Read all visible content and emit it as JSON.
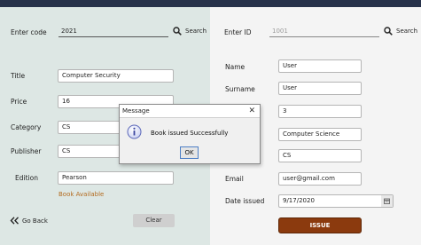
{
  "left": {
    "code_label": "Enter code",
    "code_value": "2021",
    "search_label": "Search",
    "title_label": "Title",
    "title_value": "Computer Security",
    "price_label": "Price",
    "price_value": "16",
    "category_label": "Category",
    "category_value": "CS",
    "publisher_label": "Publisher",
    "publisher_value": "CS",
    "edition_label": "Edition",
    "edition_value": "Pearson",
    "availability": "Book Available",
    "go_back_label": "Go Back",
    "clear_label": "Clear"
  },
  "right": {
    "id_label": "Enter ID",
    "id_placeholder": "1001",
    "search_label": "Search",
    "name_label": "Name",
    "name_value": "User",
    "surname_label": "Surname",
    "surname_value": "User",
    "field3_value": "3",
    "field4_value": "Computer Science",
    "field5_value": "CS",
    "email_label": "Email",
    "email_value": "user@gmail.com",
    "date_label": "Date issued",
    "date_value": "9/17/2020",
    "issue_label": "ISSUE"
  },
  "dialog": {
    "title": "Message",
    "message": "Book issued Successfully",
    "ok_label": "OK"
  },
  "colors": {
    "topbar": "#27324a",
    "left_panel": "#dde7e4",
    "right_panel": "#f4f4f4",
    "issue_button": "#8b3a0e",
    "availability_text": "#b36b1f"
  }
}
